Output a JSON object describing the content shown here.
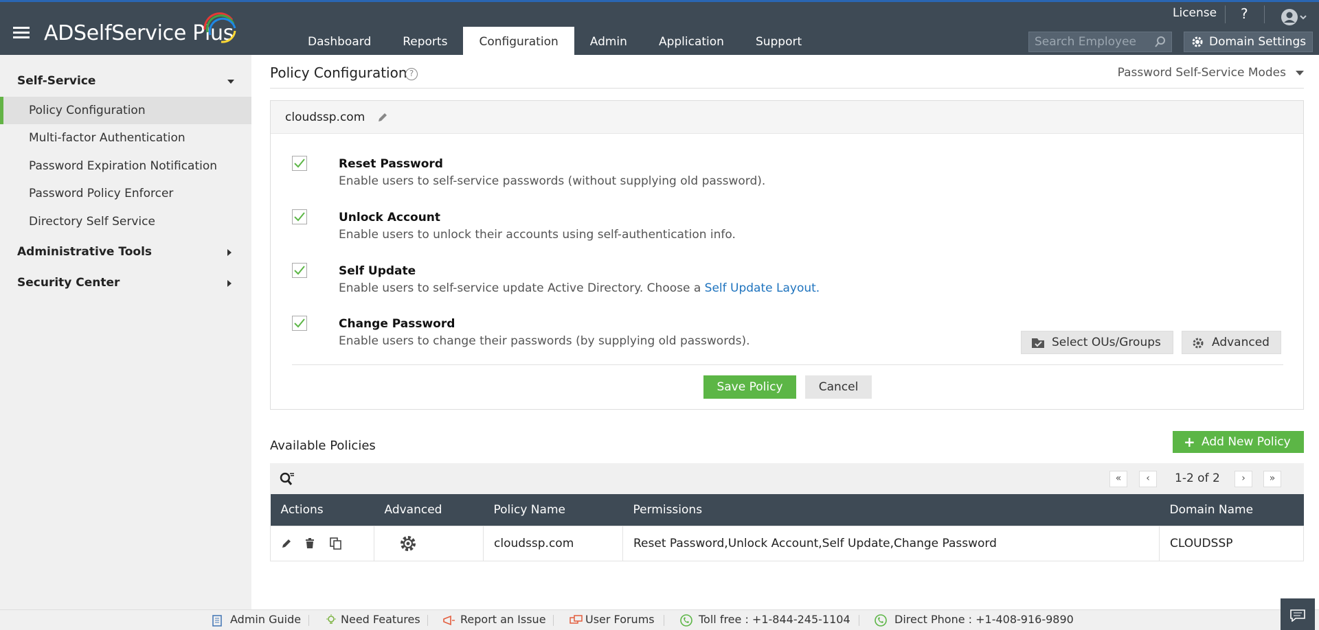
{
  "app": {
    "name": "ADSelfService Plus"
  },
  "top_nav": {
    "tabs": [
      {
        "label": "Dashboard"
      },
      {
        "label": "Reports"
      },
      {
        "label": "Configuration"
      },
      {
        "label": "Admin"
      },
      {
        "label": "Application"
      },
      {
        "label": "Support"
      }
    ],
    "active_tab": "Configuration",
    "license_label": "License",
    "help_label": "?",
    "search_placeholder": "Search Employee",
    "domain_settings_label": "Domain Settings"
  },
  "sidebar": {
    "sections": [
      {
        "label": "Self-Service",
        "expanded": true
      },
      {
        "label": "Administrative Tools",
        "expanded": false
      },
      {
        "label": "Security Center",
        "expanded": false
      }
    ],
    "items": [
      {
        "label": "Policy Configuration",
        "active": true
      },
      {
        "label": "Multi-factor Authentication"
      },
      {
        "label": "Password Expiration Notification"
      },
      {
        "label": "Password Policy Enforcer"
      },
      {
        "label": "Directory Self Service"
      }
    ]
  },
  "main": {
    "title": "Policy Configuration",
    "modes_dropdown": "Password Self-Service Modes",
    "policy_name": "cloudssp.com",
    "options": [
      {
        "title": "Reset Password",
        "description": "Enable users to self-service passwords (without supplying old password).",
        "checked": true
      },
      {
        "title": "Unlock Account",
        "description": "Enable users to unlock their accounts using self-authentication info.",
        "checked": true
      },
      {
        "title": "Self Update",
        "description": "Enable users to self-service update Active Directory. Choose a ",
        "link": "Self Update Layout.",
        "checked": true
      },
      {
        "title": "Change Password",
        "description": "Enable users to change their passwords (by supplying old passwords).",
        "checked": true
      }
    ],
    "select_ous_label": "Select OUs/Groups",
    "advanced_label": "Advanced",
    "save_label": "Save Policy",
    "cancel_label": "Cancel"
  },
  "available": {
    "title": "Available Policies",
    "add_label": "Add New Policy",
    "pagination": "1-2 of 2",
    "columns": [
      "Actions",
      "Advanced",
      "Policy Name",
      "Permissions",
      "Domain Name"
    ],
    "rows": [
      {
        "policy_name": "cloudssp.com",
        "permissions": "Reset Password,Unlock Account,Self Update,Change Password",
        "domain": "CLOUDSSP"
      }
    ]
  },
  "footer": {
    "admin_guide": "Admin Guide",
    "need_features": "Need Features",
    "report_issue": "Report an Issue",
    "user_forums": "User Forums",
    "toll_free": "Toll free : +1-844-245-1104",
    "direct_phone": "Direct Phone : +1-408-916-9890"
  },
  "colors": {
    "header_bg": "#3e4a55",
    "accent_green": "#5cb646",
    "link_blue": "#1e73be"
  }
}
